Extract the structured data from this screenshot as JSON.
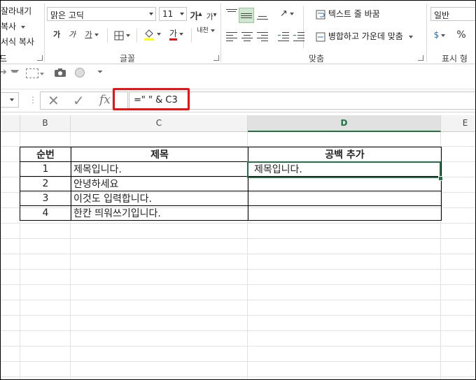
{
  "clipboard": {
    "cut": "잘라내기",
    "copy": "복사",
    "format_painter": "서식 복사",
    "group_tail": "드"
  },
  "font": {
    "name": "맑은 고딕",
    "size": "11",
    "grow": "가",
    "shrink": "가",
    "bold": "가",
    "italic": "가",
    "underline": "가",
    "font_color": "가",
    "phonetic": "내천",
    "group_label": "글꼴"
  },
  "alignment": {
    "wrap_text": "텍스트 줄 바꿈",
    "merge_center": "병합하고 가운데 맞춤",
    "group_label": "맞춤"
  },
  "number": {
    "format": "일반",
    "percent": "%",
    "group_label": "표시 형"
  },
  "formula_bar": {
    "cancel": "✕",
    "enter": "✓",
    "fx": "fx",
    "formula": "=\" \" & C3"
  },
  "columns": [
    "B",
    "C",
    "D",
    "E"
  ],
  "table": {
    "headers": [
      "순번",
      "제목",
      "공백 추가"
    ],
    "rows": [
      [
        "1",
        "제목입니다.",
        "제목입니다."
      ],
      [
        "2",
        "안녕하세요",
        ""
      ],
      [
        "3",
        "이것도 입력합니다.",
        ""
      ],
      [
        "4",
        "한칸 띄워쓰기입니다.",
        ""
      ]
    ]
  },
  "colors": {
    "accent": "#217346",
    "highlight_box": "#ee1111"
  }
}
